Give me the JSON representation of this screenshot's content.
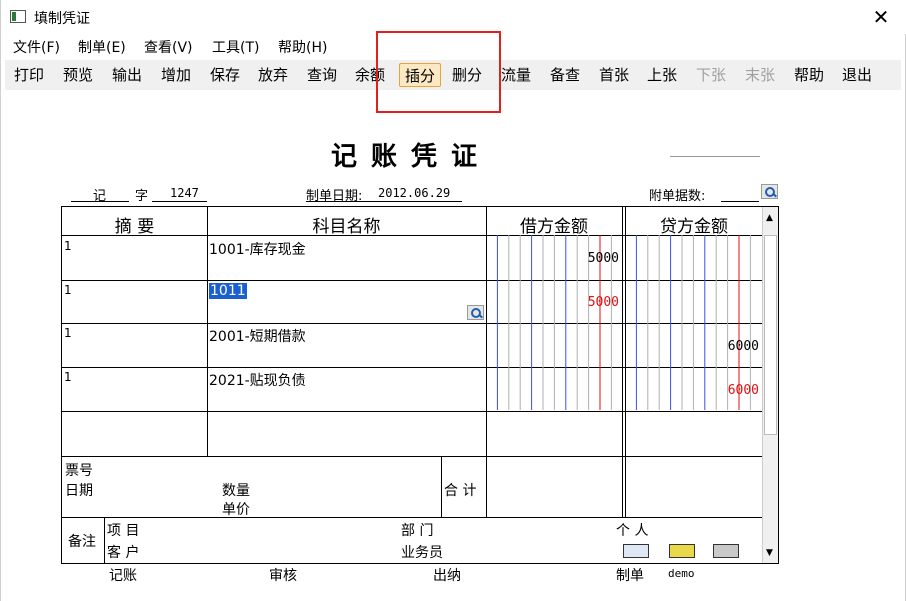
{
  "window": {
    "title": "填制凭证",
    "close": "✕"
  },
  "menu": [
    "文件(F)",
    "制单(E)",
    "查看(V)",
    "工具(T)",
    "帮助(H)"
  ],
  "toolbar": [
    "打印",
    "预览",
    "输出",
    "增加",
    "保存",
    "放弃",
    "查询",
    "余额",
    "插分",
    "删分",
    "流量",
    "备查",
    "首张",
    "上张",
    "下张",
    "末张",
    "帮助",
    "退出"
  ],
  "toolbar_state": {
    "active": "插分",
    "disabled": [
      "下张",
      "末张"
    ]
  },
  "voucher": {
    "title": "记账凭证",
    "type": "记",
    "zi": "字",
    "number": "1247",
    "date_label": "制单日期:",
    "date": "2012.06.29",
    "attachments_label": "附单据数:"
  },
  "columns": {
    "summary": "摘  要",
    "account": "科目名称",
    "debit": "借方金额",
    "credit": "贷方金额"
  },
  "rows": [
    {
      "summary": "1",
      "account": "1001-库存现金",
      "debit": "5000",
      "debit_red": "",
      "credit": "",
      "credit_red": ""
    },
    {
      "summary": "1",
      "account": "1011",
      "debit": "",
      "debit_red": "5000",
      "credit": "",
      "credit_red": ""
    },
    {
      "summary": "1",
      "account": "2001-短期借款",
      "debit": "",
      "debit_red": "",
      "credit": "6000",
      "credit_red": ""
    },
    {
      "summary": "1",
      "account": "2021-贴现负债",
      "debit": "",
      "debit_red": "",
      "credit": "",
      "credit_red": "6000"
    }
  ],
  "footer": {
    "ticket_no": "票号",
    "date": "日期",
    "quantity": "数量",
    "unit_price": "单价",
    "total": "合 计",
    "remark": "备注",
    "project": "项  目",
    "customer": "客  户",
    "department": "部  门",
    "salesperson": "业务员",
    "person": "个  人"
  },
  "signatures": {
    "bookkeeping": "记账",
    "review": "审核",
    "cashier": "出纳",
    "maker": "制单",
    "maker_name": "demo"
  },
  "colors": {
    "accent_active": "#e8a33a",
    "highlight": "#e0201a",
    "selection": "#1a60d0",
    "blue_grid": "#3b4fe0",
    "red_grid": "#e01010"
  }
}
